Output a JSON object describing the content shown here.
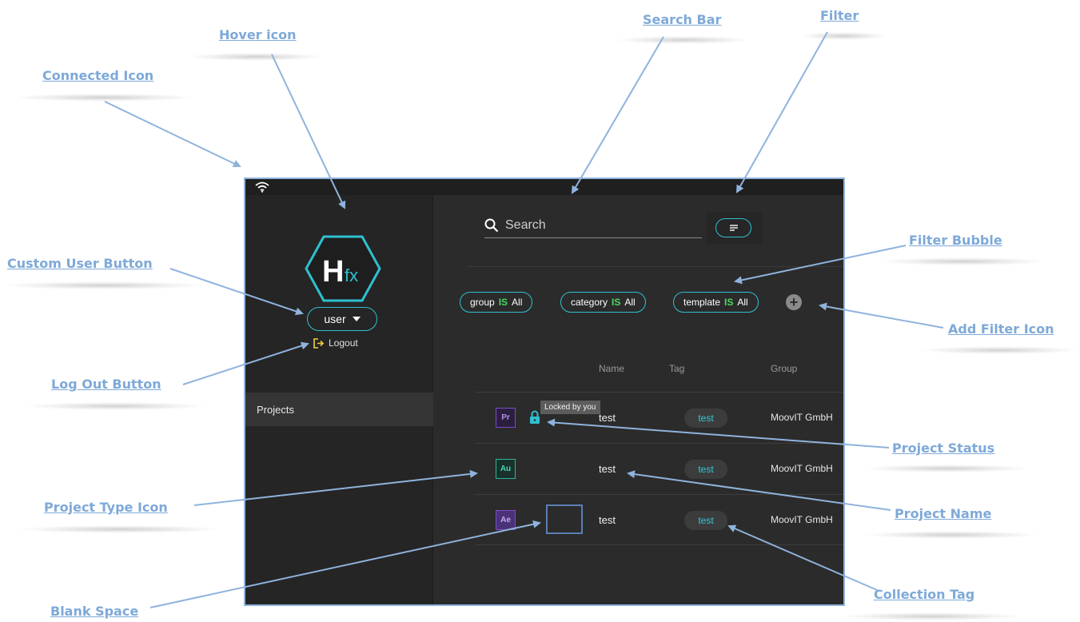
{
  "app": {
    "logo_text": "Hfx",
    "user_button_label": "user",
    "logout_label": "Logout",
    "nav": [
      {
        "label": "Projects"
      }
    ],
    "search": {
      "placeholder": "Search",
      "value": ""
    },
    "filters": [
      {
        "field": "group",
        "op": "IS",
        "value": "All"
      },
      {
        "field": "category",
        "op": "IS",
        "value": "All"
      },
      {
        "field": "template",
        "op": "IS",
        "value": "All"
      }
    ],
    "columns": {
      "name": "Name",
      "tag": "Tag",
      "group": "Group"
    },
    "rows": [
      {
        "type_label": "Pr",
        "name": "test",
        "tag": "test",
        "group": "MoovIT GmbH",
        "status_tooltip": "Locked by you"
      },
      {
        "type_label": "Au",
        "name": "test",
        "tag": "test",
        "group": "MoovIT GmbH"
      },
      {
        "type_label": "Ae",
        "name": "test",
        "tag": "test",
        "group": "MoovIT GmbH"
      }
    ],
    "colors": {
      "accent": "#2fc0d0",
      "is_green": "#4cd964",
      "lock": "#2fc0d0",
      "logout_icon": "#f2d23c"
    },
    "icons": [
      "wifi-icon",
      "search-icon",
      "filter-icon",
      "caret-down-icon",
      "logout-icon",
      "lock-icon",
      "add-icon"
    ]
  },
  "annotations": {
    "connected_icon": "Connected Icon",
    "hover_icon": "Hover icon",
    "search_bar": "Search Bar",
    "filter": "Filter",
    "filter_bubble": "Filter Bubble",
    "custom_user_button": "Custom User Button",
    "log_out_button": "Log Out Button",
    "add_filter_icon": "Add Filter Icon",
    "project_status": "Project Status",
    "project_type_icon": "Project Type Icon",
    "project_name": "Project Name",
    "collection_tag": "Collection Tag",
    "blank_space": "Blank Space"
  }
}
